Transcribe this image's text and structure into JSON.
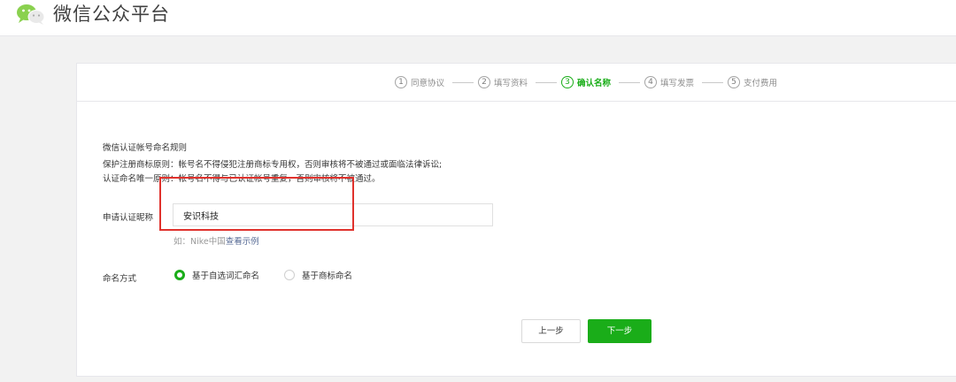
{
  "header": {
    "title": "微信公众平台"
  },
  "steps": [
    {
      "num": "1",
      "label": "同意协议",
      "active": false
    },
    {
      "num": "2",
      "label": "填写资料",
      "active": false
    },
    {
      "num": "3",
      "label": "确认名称",
      "active": true
    },
    {
      "num": "4",
      "label": "填写发票",
      "active": false
    },
    {
      "num": "5",
      "label": "支付费用",
      "active": false
    }
  ],
  "rules": {
    "title": "微信认证帐号命名规则",
    "lines": [
      "保护注册商标原则：帐号名不得侵犯注册商标专用权，否则审核将不被通过或面临法律诉讼;",
      "认证命名唯一原则：帐号名不得与已认证帐号重复，否则审核将不被通过。"
    ]
  },
  "form": {
    "nickname_label": "申请认证昵称",
    "nickname_value": "安识科技",
    "hint_prefix": "如：Nike中国",
    "hint_link": "查看示例",
    "naming_label": "命名方式",
    "naming_options": [
      {
        "label": "基于自选词汇命名",
        "checked": true
      },
      {
        "label": "基于商标命名",
        "checked": false
      }
    ]
  },
  "buttons": {
    "prev": "上一步",
    "next": "下一步"
  },
  "colors": {
    "accent": "#1aad19",
    "highlight": "#e0322d",
    "link": "#576b95"
  }
}
